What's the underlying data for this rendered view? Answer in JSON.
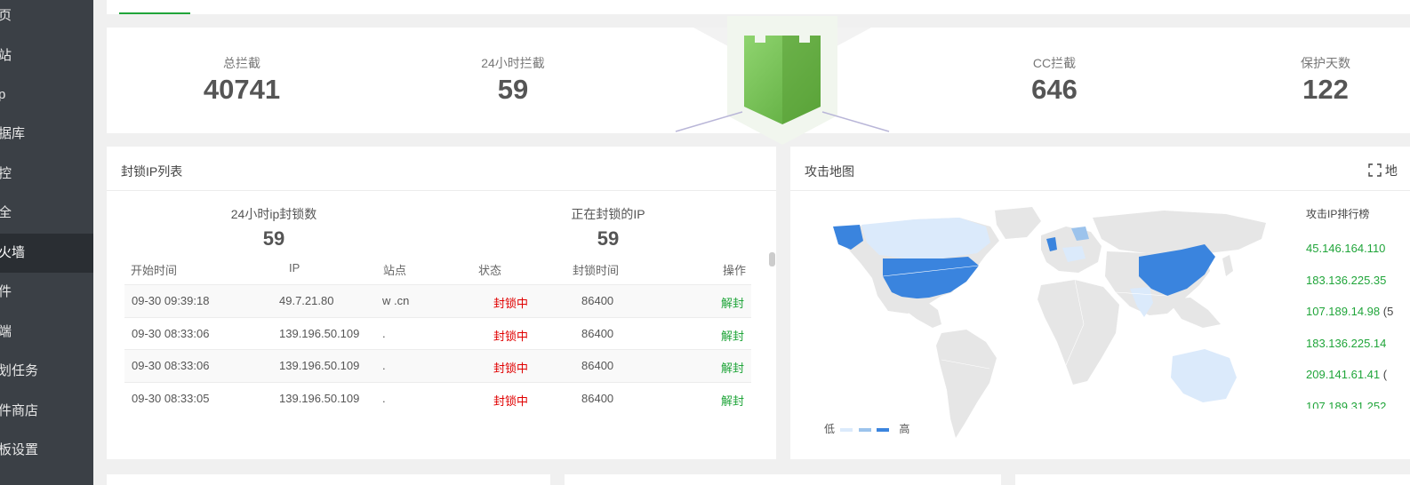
{
  "sidebar": {
    "items": [
      {
        "label": "页"
      },
      {
        "label": "站"
      },
      {
        "label": "p"
      },
      {
        "label": "据库"
      },
      {
        "label": "控"
      },
      {
        "label": "全"
      },
      {
        "label": "火墙"
      },
      {
        "label": "件"
      },
      {
        "label": "端"
      },
      {
        "label": "划任务"
      },
      {
        "label": "件商店"
      },
      {
        "label": "板设置"
      }
    ],
    "active_index": 6
  },
  "stats": {
    "total_blocked": {
      "label": "总拦截",
      "value": "40741"
    },
    "blocked_24h": {
      "label": "24小时拦截",
      "value": "59"
    },
    "cc_blocked": {
      "label": "CC拦截",
      "value": "646"
    },
    "protect_days": {
      "label": "保护天数",
      "value": "122"
    }
  },
  "block_panel": {
    "title": "封锁IP列表",
    "summary": {
      "blocked_24h": {
        "label": "24小时ip封锁数",
        "value": "59"
      },
      "blocking_now": {
        "label": "正在封锁的IP",
        "value": "59"
      }
    },
    "columns": {
      "start_time": "开始时间",
      "ip": "IP",
      "site": "站点",
      "status": "状态",
      "block_time": "封锁时间",
      "action": "操作"
    },
    "rows": [
      {
        "start_time": "09-30 09:39:18",
        "ip": "49.7.21.80",
        "site": "w        .cn",
        "status": "封锁中",
        "block_time": "86400",
        "action": "解封"
      },
      {
        "start_time": "09-30 08:33:06",
        "ip": "139.196.50.109",
        "site": ".",
        "status": "封锁中",
        "block_time": "86400",
        "action": "解封"
      },
      {
        "start_time": "09-30 08:33:06",
        "ip": "139.196.50.109",
        "site": ".",
        "status": "封锁中",
        "block_time": "86400",
        "action": "解封"
      },
      {
        "start_time": "09-30 08:33:05",
        "ip": "139.196.50.109",
        "site": ".",
        "status": "封锁中",
        "block_time": "86400",
        "action": "解封"
      }
    ]
  },
  "map_panel": {
    "title": "攻击地图",
    "fullscreen_label": "地",
    "ranking_title": "攻击IP排行榜",
    "ranking": [
      {
        "ip": "45.146.164.110"
      },
      {
        "ip": "183.136.225.35"
      },
      {
        "ip": "107.189.14.98",
        "suffix": "(5"
      },
      {
        "ip": "183.136.225.14"
      },
      {
        "ip": "209.141.61.41",
        "suffix": "("
      },
      {
        "ip": "107.189.31.252"
      }
    ],
    "legend": {
      "low": "低",
      "high": "高"
    },
    "colors": {
      "low": "#dbeafb",
      "mid": "#9cc3ec",
      "high": "#3a84de",
      "land": "#e6e6e6"
    }
  },
  "colors": {
    "accent": "#20a53a",
    "danger": "#e00000",
    "sidebar": "#3b4046"
  }
}
